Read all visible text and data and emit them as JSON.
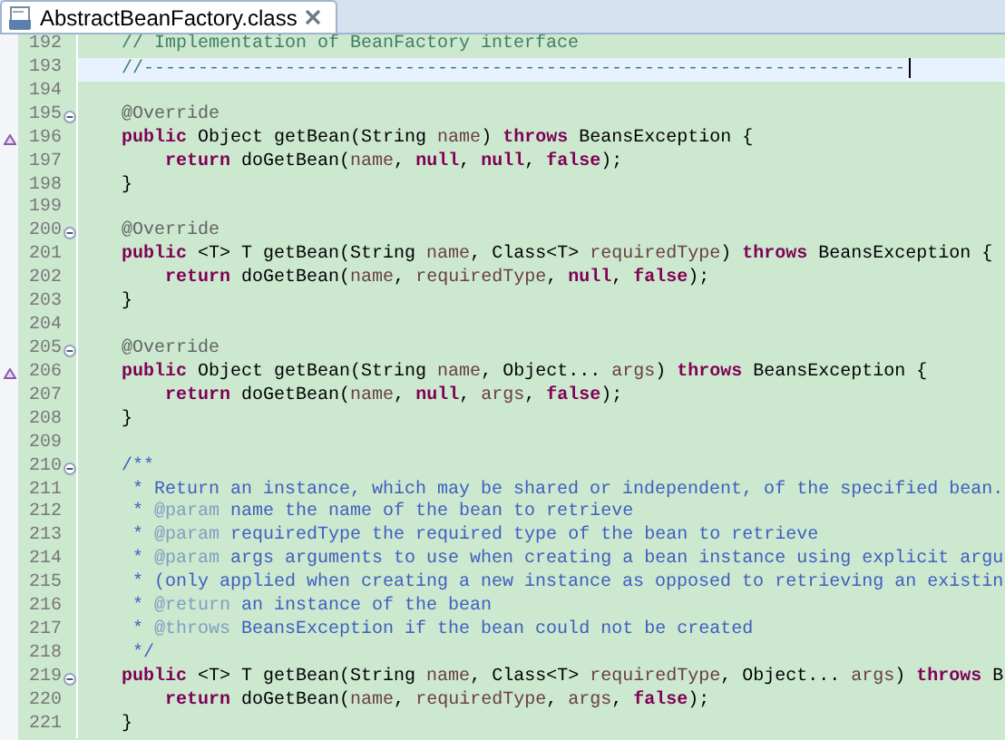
{
  "tab": {
    "title": "AbstractBeanFactory.class",
    "selected": true
  },
  "lines": [
    {
      "number": "192",
      "segments": [
        {
          "kind": "comment",
          "text": "    // Implementation of BeanFactory interface"
        }
      ]
    },
    {
      "number": "193",
      "current": true,
      "segments": [
        {
          "kind": "comment",
          "text": "    //----------------------------------------------------------------------"
        }
      ]
    },
    {
      "number": "194"
    },
    {
      "number": "195",
      "fold": true,
      "segments": [
        {
          "kind": "annotation",
          "text": "    @Override"
        }
      ]
    },
    {
      "number": "196",
      "override": true,
      "segments": [
        {
          "kind": "keyword",
          "text": "    public"
        },
        {
          "kind": "plain",
          "text": " Object getBean(String "
        },
        {
          "kind": "variable",
          "text": "name"
        },
        {
          "kind": "plain",
          "text": ") "
        },
        {
          "kind": "keyword",
          "text": "throws"
        },
        {
          "kind": "plain",
          "text": " BeansException {"
        }
      ]
    },
    {
      "number": "197",
      "segments": [
        {
          "kind": "keyword",
          "text": "        return"
        },
        {
          "kind": "plain",
          "text": " doGetBean("
        },
        {
          "kind": "variable",
          "text": "name"
        },
        {
          "kind": "plain",
          "text": ", "
        },
        {
          "kind": "keyword",
          "text": "null"
        },
        {
          "kind": "plain",
          "text": ", "
        },
        {
          "kind": "keyword",
          "text": "null"
        },
        {
          "kind": "plain",
          "text": ", "
        },
        {
          "kind": "keyword",
          "text": "false"
        },
        {
          "kind": "plain",
          "text": ");"
        }
      ]
    },
    {
      "number": "198",
      "segments": [
        {
          "kind": "plain",
          "text": "    }"
        }
      ]
    },
    {
      "number": "199"
    },
    {
      "number": "200",
      "fold": true,
      "segments": [
        {
          "kind": "annotation",
          "text": "    @Override"
        }
      ]
    },
    {
      "number": "201",
      "segments": [
        {
          "kind": "keyword",
          "text": "    public"
        },
        {
          "kind": "plain",
          "text": " <T> T getBean(String "
        },
        {
          "kind": "variable",
          "text": "name"
        },
        {
          "kind": "plain",
          "text": ", Class<T> "
        },
        {
          "kind": "variable",
          "text": "requiredType"
        },
        {
          "kind": "plain",
          "text": ") "
        },
        {
          "kind": "keyword",
          "text": "throws"
        },
        {
          "kind": "plain",
          "text": " BeansException {"
        }
      ]
    },
    {
      "number": "202",
      "segments": [
        {
          "kind": "keyword",
          "text": "        return"
        },
        {
          "kind": "plain",
          "text": " doGetBean("
        },
        {
          "kind": "variable",
          "text": "name"
        },
        {
          "kind": "plain",
          "text": ", "
        },
        {
          "kind": "variable",
          "text": "requiredType"
        },
        {
          "kind": "plain",
          "text": ", "
        },
        {
          "kind": "keyword",
          "text": "null"
        },
        {
          "kind": "plain",
          "text": ", "
        },
        {
          "kind": "keyword",
          "text": "false"
        },
        {
          "kind": "plain",
          "text": ");"
        }
      ]
    },
    {
      "number": "203",
      "segments": [
        {
          "kind": "plain",
          "text": "    }"
        }
      ]
    },
    {
      "number": "204"
    },
    {
      "number": "205",
      "fold": true,
      "segments": [
        {
          "kind": "annotation",
          "text": "    @Override"
        }
      ]
    },
    {
      "number": "206",
      "override": true,
      "segments": [
        {
          "kind": "keyword",
          "text": "    public"
        },
        {
          "kind": "plain",
          "text": " Object getBean(String "
        },
        {
          "kind": "variable",
          "text": "name"
        },
        {
          "kind": "plain",
          "text": ", Object... "
        },
        {
          "kind": "variable",
          "text": "args"
        },
        {
          "kind": "plain",
          "text": ") "
        },
        {
          "kind": "keyword",
          "text": "throws"
        },
        {
          "kind": "plain",
          "text": " BeansException {"
        }
      ]
    },
    {
      "number": "207",
      "segments": [
        {
          "kind": "keyword",
          "text": "        return"
        },
        {
          "kind": "plain",
          "text": " doGetBean("
        },
        {
          "kind": "variable",
          "text": "name"
        },
        {
          "kind": "plain",
          "text": ", "
        },
        {
          "kind": "keyword",
          "text": "null"
        },
        {
          "kind": "plain",
          "text": ", "
        },
        {
          "kind": "variable",
          "text": "args"
        },
        {
          "kind": "plain",
          "text": ", "
        },
        {
          "kind": "keyword",
          "text": "false"
        },
        {
          "kind": "plain",
          "text": ");"
        }
      ]
    },
    {
      "number": "208",
      "segments": [
        {
          "kind": "plain",
          "text": "    }"
        }
      ]
    },
    {
      "number": "209"
    },
    {
      "number": "210",
      "fold": true,
      "segments": [
        {
          "kind": "javadoc",
          "text": "    /**"
        }
      ]
    },
    {
      "number": "211",
      "segments": [
        {
          "kind": "javadoc",
          "text": "     * Return an instance, which may be shared or independent, of the specified bean."
        }
      ]
    },
    {
      "number": "212",
      "segments": [
        {
          "kind": "javadoc",
          "text": "     * "
        },
        {
          "kind": "javadoc_tag",
          "text": "@param"
        },
        {
          "kind": "javadoc",
          "text": " name the name of the bean to retrieve"
        }
      ]
    },
    {
      "number": "213",
      "segments": [
        {
          "kind": "javadoc",
          "text": "     * "
        },
        {
          "kind": "javadoc_tag",
          "text": "@param"
        },
        {
          "kind": "javadoc",
          "text": " requiredType the required type of the bean to retrieve"
        }
      ]
    },
    {
      "number": "214",
      "segments": [
        {
          "kind": "javadoc",
          "text": "     * "
        },
        {
          "kind": "javadoc_tag",
          "text": "@param"
        },
        {
          "kind": "javadoc",
          "text": " args arguments to use when creating a bean instance using explicit argu"
        }
      ]
    },
    {
      "number": "215",
      "segments": [
        {
          "kind": "javadoc",
          "text": "     * (only applied when creating a new instance as opposed to retrieving an existin"
        }
      ]
    },
    {
      "number": "216",
      "segments": [
        {
          "kind": "javadoc",
          "text": "     * "
        },
        {
          "kind": "javadoc_tag",
          "text": "@return"
        },
        {
          "kind": "javadoc",
          "text": " an instance of the bean"
        }
      ]
    },
    {
      "number": "217",
      "segments": [
        {
          "kind": "javadoc",
          "text": "     * "
        },
        {
          "kind": "javadoc_tag",
          "text": "@throws"
        },
        {
          "kind": "javadoc",
          "text": " BeansException if the bean could not be created"
        }
      ]
    },
    {
      "number": "218",
      "segments": [
        {
          "kind": "javadoc",
          "text": "     */"
        }
      ]
    },
    {
      "number": "219",
      "fold": true,
      "segments": [
        {
          "kind": "keyword",
          "text": "    public"
        },
        {
          "kind": "plain",
          "text": " <T> T getBean(String "
        },
        {
          "kind": "variable",
          "text": "name"
        },
        {
          "kind": "plain",
          "text": ", Class<T> "
        },
        {
          "kind": "variable",
          "text": "requiredType"
        },
        {
          "kind": "plain",
          "text": ", Object... "
        },
        {
          "kind": "variable",
          "text": "args"
        },
        {
          "kind": "plain",
          "text": ") "
        },
        {
          "kind": "keyword",
          "text": "throws"
        },
        {
          "kind": "plain",
          "text": " B"
        }
      ]
    },
    {
      "number": "220",
      "segments": [
        {
          "kind": "keyword",
          "text": "        return"
        },
        {
          "kind": "plain",
          "text": " doGetBean("
        },
        {
          "kind": "variable",
          "text": "name"
        },
        {
          "kind": "plain",
          "text": ", "
        },
        {
          "kind": "variable",
          "text": "requiredType"
        },
        {
          "kind": "plain",
          "text": ", "
        },
        {
          "kind": "variable",
          "text": "args"
        },
        {
          "kind": "plain",
          "text": ", "
        },
        {
          "kind": "keyword",
          "text": "false"
        },
        {
          "kind": "plain",
          "text": ");"
        }
      ]
    },
    {
      "number": "221",
      "segments": [
        {
          "kind": "plain",
          "text": "    }"
        }
      ]
    }
  ]
}
